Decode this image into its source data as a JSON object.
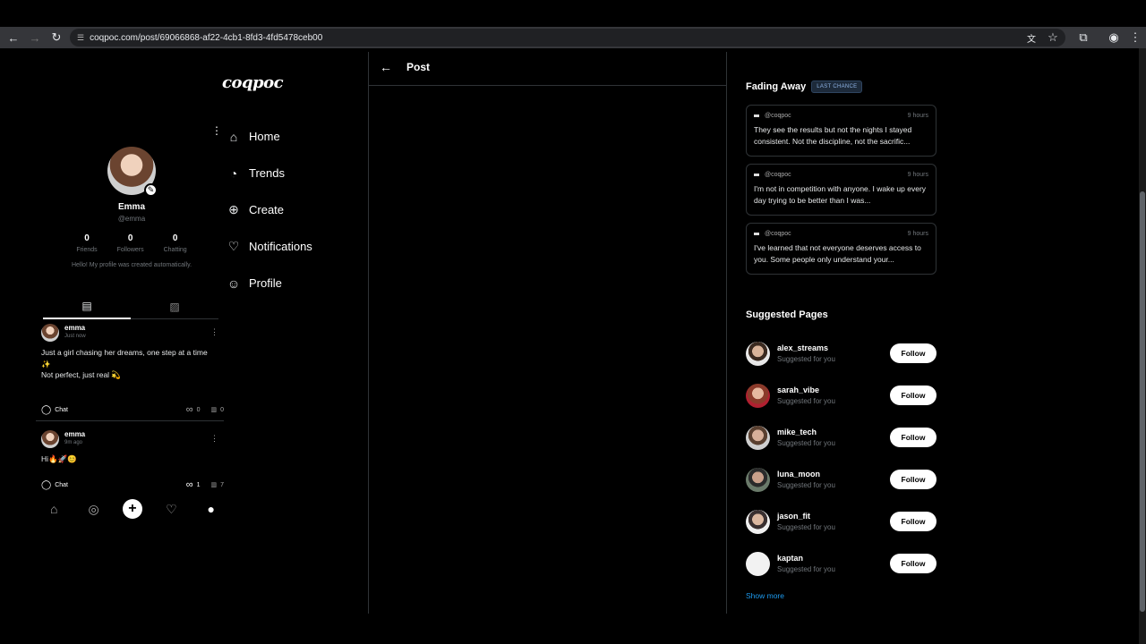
{
  "browser": {
    "url": "coqpoc.com/post/69066868-af22-4cb1-8fd3-4fd5478ceb00"
  },
  "brand": {
    "logo": "coqpoc"
  },
  "nav": {
    "items": [
      {
        "label": "Home"
      },
      {
        "label": "Trends"
      },
      {
        "label": "Create"
      },
      {
        "label": "Notifications"
      },
      {
        "label": "Profile"
      }
    ]
  },
  "profile": {
    "name": "Emma",
    "handle": "@emma",
    "stats": [
      {
        "value": "0",
        "label": "Friends"
      },
      {
        "value": "0",
        "label": "Followers"
      },
      {
        "value": "0",
        "label": "Chatting"
      }
    ],
    "bio": "Hello! My profile was created automatically."
  },
  "posts": [
    {
      "user": "emma",
      "time": "Just now",
      "line1": "Just a girl chasing her dreams, one step at a time",
      "line2": "✨",
      "line3": "Not perfect, just real 💫",
      "chat": "Chat",
      "reposts": "0",
      "views": "0"
    },
    {
      "user": "emma",
      "time": "9m ago",
      "line1": "Hi🔥🚀😊",
      "chat": "Chat",
      "reposts": "1",
      "views": "7"
    }
  ],
  "center": {
    "title": "Post"
  },
  "fading": {
    "title": "Fading Away",
    "badge": "LAST CHANCE",
    "cards": [
      {
        "handle": "@coqpoc",
        "time": "9 hours",
        "text": "They see the results but not the nights I stayed consistent. Not the discipline, not the sacrific..."
      },
      {
        "handle": "@coqpoc",
        "time": "9 hours",
        "text": "I'm not in competition with anyone. I wake up every day trying to be better than I was..."
      },
      {
        "handle": "@coqpoc",
        "time": "9 hours",
        "text": "I've learned that not everyone deserves access to you. Some people only understand your..."
      }
    ]
  },
  "suggested": {
    "title": "Suggested Pages",
    "items": [
      {
        "name": "alex_streams",
        "sub": "Suggested for you",
        "button": "Follow"
      },
      {
        "name": "sarah_vibe",
        "sub": "Suggested for you",
        "button": "Follow"
      },
      {
        "name": "mike_tech",
        "sub": "Suggested for you",
        "button": "Follow"
      },
      {
        "name": "luna_moon",
        "sub": "Suggested for you",
        "button": "Follow"
      },
      {
        "name": "jason_fit",
        "sub": "Suggested for you",
        "button": "Follow"
      },
      {
        "name": "kaptan",
        "sub": "Suggested for you",
        "button": "Follow"
      }
    ],
    "show_more": "Show more"
  }
}
